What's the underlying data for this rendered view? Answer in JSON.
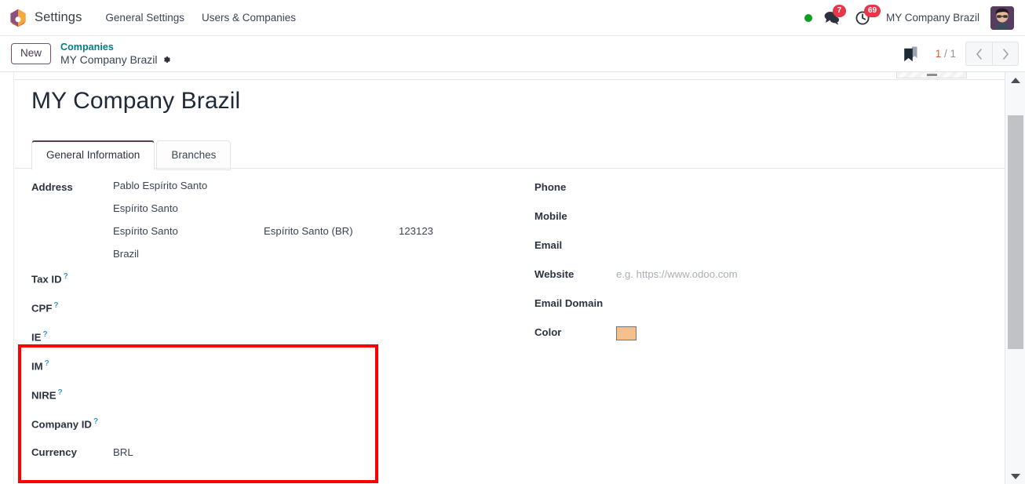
{
  "navbar": {
    "logo_icon": "odoo-hexagon-logo",
    "app_name": "Settings",
    "menu_items": [
      {
        "label": "General Settings",
        "name": "general-settings"
      },
      {
        "label": "Users & Companies",
        "name": "users-and-companies"
      }
    ],
    "presence_icon": "presence-dot-online",
    "presence_color": "#0f9d21",
    "messages_icon": "messages-icon",
    "messages_count": "7",
    "activities_icon": "activities-clock-icon",
    "activities_count": "69",
    "badge_color": "#e6384a",
    "company_name": "MY Company Brazil",
    "avatar_icon": "user-avatar"
  },
  "control_panel": {
    "new_label": "New",
    "breadcrumb_parent": "Companies",
    "breadcrumb_current": "MY Company Brazil",
    "gear_icon": "gear-icon",
    "bookmark_icon": "bookmark-icon",
    "pager_current": "1",
    "pager_separator": " / ",
    "pager_total": "1",
    "prev_icon": "chevron-left-icon",
    "next_icon": "chevron-right-icon"
  },
  "record": {
    "title": "MY Company Brazil",
    "tabs": [
      {
        "label": "General Information",
        "name": "tab-general-information",
        "active": true
      },
      {
        "label": "Branches",
        "name": "tab-branches",
        "active": false
      }
    ]
  },
  "left_column": {
    "address": {
      "label": "Address",
      "line1": "Pablo Espírito Santo",
      "line2": "Espírito Santo",
      "city": "Espírito Santo",
      "state": "Espírito Santo (BR)",
      "zip": "123123",
      "country": "Brazil"
    },
    "tax_fields": [
      {
        "label": "Tax ID",
        "value": "",
        "help": "?",
        "name": "tax-id"
      },
      {
        "label": "CPF",
        "value": "",
        "help": "?",
        "name": "cpf"
      },
      {
        "label": "IE",
        "value": "",
        "help": "?",
        "name": "ie"
      },
      {
        "label": "IM",
        "value": "",
        "help": "?",
        "name": "im"
      },
      {
        "label": "NIRE",
        "value": "",
        "help": "?",
        "name": "nire"
      }
    ],
    "company_id": {
      "label": "Company ID",
      "value": "",
      "help": "?"
    },
    "currency": {
      "label": "Currency",
      "value": "BRL"
    }
  },
  "right_column": {
    "phone": {
      "label": "Phone",
      "value": ""
    },
    "mobile": {
      "label": "Mobile",
      "value": ""
    },
    "email": {
      "label": "Email",
      "value": ""
    },
    "website": {
      "label": "Website",
      "value": "",
      "placeholder": "e.g. https://www.odoo.com"
    },
    "email_domain": {
      "label": "Email Domain",
      "value": ""
    },
    "color": {
      "label": "Color",
      "swatch_hex": "#f5c08e"
    }
  },
  "annotation": {
    "highlight_color": "#fb0000"
  },
  "scrollbar": {
    "up_icon": "scroll-up-arrow",
    "down_icon": "scroll-down-arrow"
  }
}
